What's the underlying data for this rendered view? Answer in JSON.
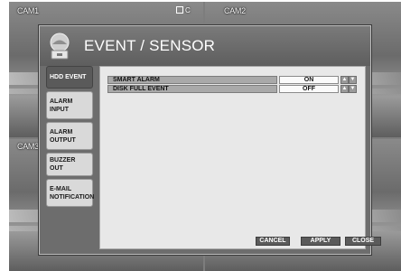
{
  "cameras": [
    {
      "label": "CAM1"
    },
    {
      "label": "CAM2"
    },
    {
      "label": "CAM3"
    }
  ],
  "rec_indicator": "C",
  "dialog": {
    "title": "EVENT / SENSOR",
    "tabs": [
      {
        "label": "HDD EVENT",
        "active": true
      },
      {
        "label": "ALARM INPUT",
        "active": false
      },
      {
        "label": "ALARM OUTPUT",
        "active": false
      },
      {
        "label": "BUZZER OUT",
        "active": false
      },
      {
        "label": "E-MAIL NOTIFICATION",
        "active": false
      }
    ],
    "settings": [
      {
        "label": "SMART ALARM",
        "value": "ON"
      },
      {
        "label": "DISK FULL EVENT",
        "value": "OFF"
      }
    ],
    "buttons": {
      "cancel": "CANCEL",
      "apply": "APPLY",
      "close": "CLOSE"
    }
  },
  "colors": {
    "dialog_bg": "#6d6d6d",
    "content_bg": "#e8e8e8",
    "active_tab": "#5a5a5a",
    "button_bg": "#5b5b5b"
  },
  "icons": [
    "logo-icon",
    "arrow-up-icon",
    "arrow-down-icon"
  ]
}
